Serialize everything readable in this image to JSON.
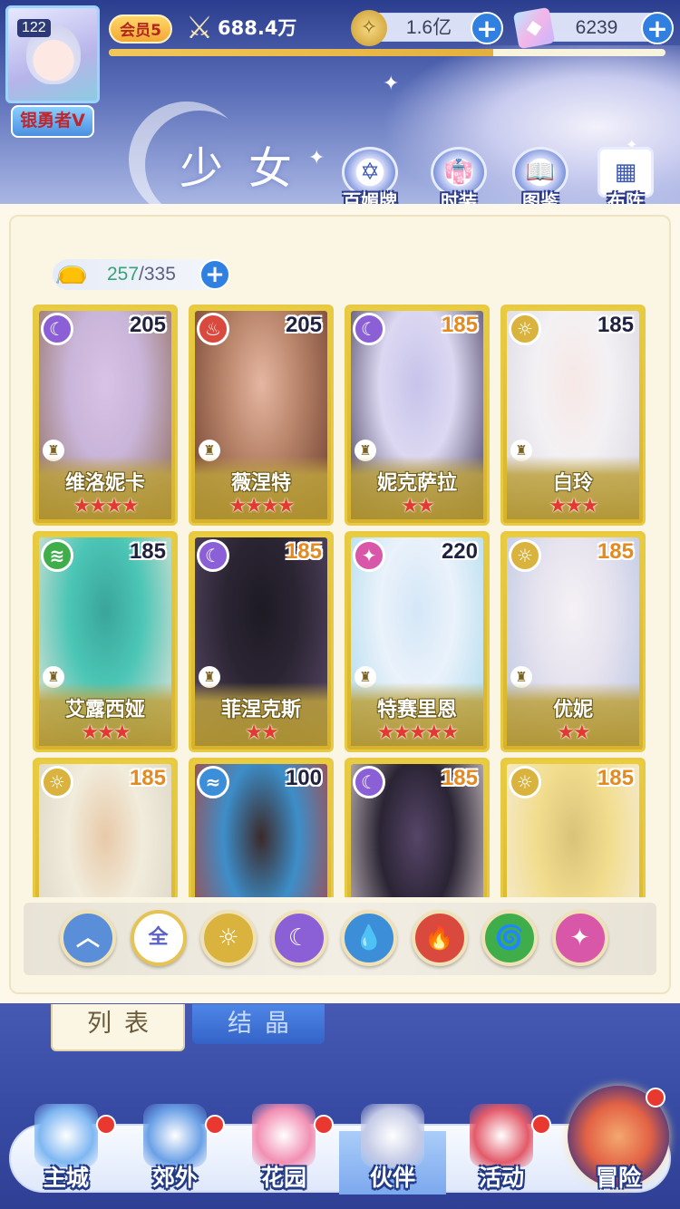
{
  "header": {
    "player_level": "122",
    "title_badge": "银勇者V",
    "vip_label": "会员5",
    "power_value": "688.4万",
    "exp_progress": 0.69,
    "gold": "1.6亿",
    "gems": "6239",
    "page_title": "少女",
    "features": [
      {
        "label": "百媚牌",
        "icon": "card-badge-icon"
      },
      {
        "label": "时装",
        "icon": "outfit-icon"
      },
      {
        "label": "图鉴",
        "icon": "book-icon"
      },
      {
        "label": "布阵",
        "icon": "formation-grid-icon"
      }
    ]
  },
  "capacity": {
    "current": "257",
    "max": "/335"
  },
  "cards": [
    {
      "name": "维洛妮卡",
      "level": "205",
      "element": "moon",
      "stars": "★★★★",
      "level_color": "#1f2140",
      "art": [
        "#c9b5d9",
        "#8f6a55",
        "#d9c3e6"
      ]
    },
    {
      "name": "薇涅特",
      "level": "205",
      "element": "fire",
      "stars": "★★★★",
      "level_color": "#1f2140",
      "art": [
        "#b9856b",
        "#6b3b2b",
        "#e6b6a2"
      ]
    },
    {
      "name": "妮克萨拉",
      "level": "185",
      "element": "moon",
      "stars": "★★",
      "level_color": "#e48a1f",
      "art": [
        "#dcd8f2",
        "#3a3250",
        "#c7c3ea"
      ]
    },
    {
      "name": "白玲",
      "level": "185",
      "element": "sun",
      "stars": "★★★",
      "level_color": "#1f2140",
      "art": [
        "#f3f1f4",
        "#d9d4e0",
        "#f7e8e6"
      ]
    },
    {
      "name": "艾露西娅",
      "level": "185",
      "element": "wind",
      "stars": "★★★",
      "level_color": "#1f2140",
      "art": [
        "#4cc6b6",
        "#f5e6dc",
        "#3aa59a"
      ]
    },
    {
      "name": "菲涅克斯",
      "level": "185",
      "element": "moon",
      "stars": "★★",
      "level_color": "#e48a1f",
      "art": [
        "#2b2533",
        "#5b4a6a",
        "#1d1a24"
      ]
    },
    {
      "name": "特赛里恩",
      "level": "220",
      "element": "star",
      "stars": "★★★★★",
      "level_color": "#1f2140",
      "art": [
        "#eaf2fb",
        "#a9d9ec",
        "#d4e7f7"
      ]
    },
    {
      "name": "优妮",
      "level": "185",
      "element": "sun",
      "stars": "★★",
      "level_color": "#e48a1f",
      "art": [
        "#e6e3ef",
        "#b8c4e2",
        "#f5f1f5"
      ]
    },
    {
      "name": "",
      "level": "185",
      "element": "sun",
      "stars": "",
      "level_color": "#e48a1f",
      "art": [
        "#f1ecdc",
        "#d8d1c0",
        "#e8c9a8"
      ]
    },
    {
      "name": "",
      "level": "100",
      "element": "water",
      "stars": "",
      "level_color": "#1f2140",
      "art": [
        "#3d8ec9",
        "#c0392b",
        "#3b2a2a"
      ]
    },
    {
      "name": "",
      "level": "185",
      "element": "moon",
      "stars": "",
      "level_color": "#e48a1f",
      "art": [
        "#2a2434",
        "#ece0e0",
        "#564568"
      ]
    },
    {
      "name": "",
      "level": "185",
      "element": "sun",
      "stars": "",
      "level_color": "#e48a1f",
      "art": [
        "#f2dd8e",
        "#f6efe6",
        "#d9c37a"
      ]
    }
  ],
  "filters": [
    {
      "name": "filter-all-elements-up",
      "label": "︿",
      "color": "#5a8ed9",
      "active": false
    },
    {
      "name": "filter-all",
      "label": "全",
      "color": "#ffffff",
      "active": true
    },
    {
      "name": "filter-sun",
      "label": "☼",
      "color": "#d9b33d",
      "active": false
    },
    {
      "name": "filter-moon",
      "label": "☾",
      "color": "#8b5fd6",
      "active": false
    },
    {
      "name": "filter-water",
      "label": "💧",
      "color": "#3d8ed9",
      "active": false
    },
    {
      "name": "filter-fire",
      "label": "🔥",
      "color": "#d9493d",
      "active": false
    },
    {
      "name": "filter-wind",
      "label": "🌀",
      "color": "#3fae4a",
      "active": false
    },
    {
      "name": "filter-star",
      "label": "✦",
      "color": "#d957a8",
      "active": false
    }
  ],
  "tabs": {
    "list": "列表",
    "crystal": "结晶"
  },
  "nav": [
    {
      "label": "主城",
      "icon": "castle-icon",
      "color": "#7fb7f2",
      "dot": true
    },
    {
      "label": "郊外",
      "icon": "portal-icon",
      "color": "#6aa0e6",
      "dot": true
    },
    {
      "label": "花园",
      "icon": "heart-garden-icon",
      "color": "#f28fb3",
      "dot": true
    },
    {
      "label": "伙伴",
      "icon": "partner-portrait-icon",
      "color": "#c5cbe6",
      "dot": false
    },
    {
      "label": "活动",
      "icon": "gift-icon",
      "color": "#e35a6a",
      "dot": true
    },
    {
      "label": "冒险",
      "icon": "compass-icon",
      "color": "#e26245",
      "dot": true
    }
  ],
  "colors": {
    "accent": "#2f80e0",
    "card_gold": "#e8c946",
    "panel_bg": "#fbf5e4"
  }
}
